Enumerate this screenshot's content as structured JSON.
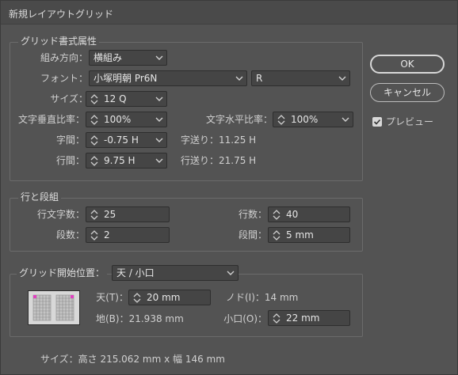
{
  "window": {
    "title": "新規レイアウトグリッド"
  },
  "buttons": {
    "ok": "OK",
    "cancel": "キャンセル"
  },
  "preview": {
    "label": "プレビュー",
    "checked": true
  },
  "grid_attributes": {
    "legend": "グリッド書式属性",
    "direction": {
      "label": "組み方向：",
      "value": "横組み"
    },
    "font": {
      "label": "フォント：",
      "family": "小塚明朝  Pr6N",
      "style": "R"
    },
    "size": {
      "label": "サイズ：",
      "value": "12 Q"
    },
    "vscale": {
      "label": "文字垂直比率：",
      "value": "100%"
    },
    "hscale": {
      "label": "文字水平比率：",
      "value": "100%"
    },
    "char_aki": {
      "label": "字間：",
      "value": "-0.75 H"
    },
    "char_feed": "字送り：11.25 H",
    "line_gap": {
      "label": "行間：",
      "value": "9.75 H"
    },
    "line_feed": "行送り：21.75 H"
  },
  "lines_columns": {
    "legend": "行と段組",
    "chars_per_line": {
      "label": "行文字数：",
      "value": "25"
    },
    "lines": {
      "label": "行数：",
      "value": "40"
    },
    "columns": {
      "label": "段数：",
      "value": "2"
    },
    "gutter": {
      "label": "段間：",
      "value": "5 mm"
    }
  },
  "start_position": {
    "legend": "グリッド開始位置：",
    "value": "天 / 小口",
    "top": {
      "label": "天(T)：",
      "value": "20 mm"
    },
    "bottom": "地(B)：21.938 mm",
    "inside": "ノド(I)：14 mm",
    "outside": {
      "label": "小口(O)：",
      "value": "22 mm"
    }
  },
  "summary": "サイズ：高さ  215.062 mm x 幅  146 mm",
  "colors": {
    "accent": "#e040c0",
    "bg": "#535353",
    "field": "#454545"
  }
}
